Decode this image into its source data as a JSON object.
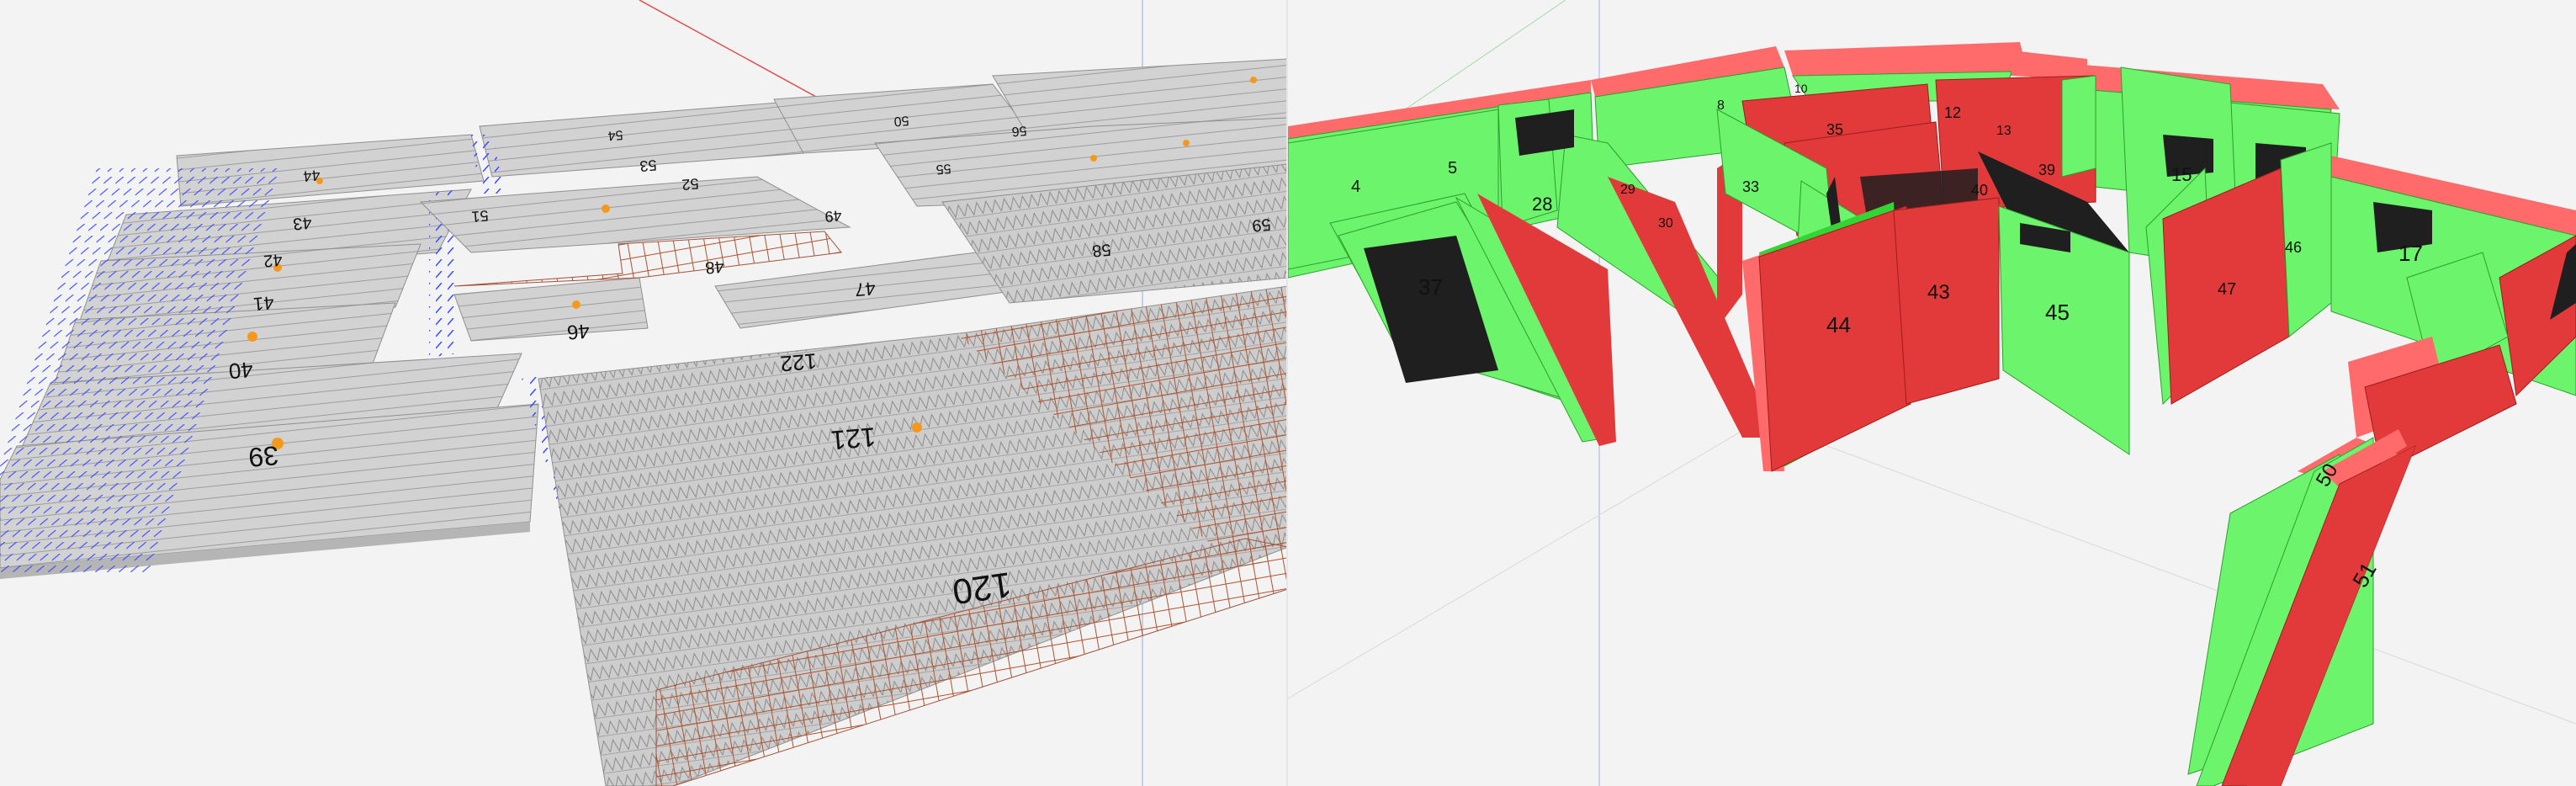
{
  "viewports": {
    "left": {
      "title": "slabs-3d-view",
      "slab_labels": [
        "44",
        "43",
        "42",
        "41",
        "40",
        "39",
        "54",
        "53",
        "52",
        "51",
        "50",
        "49",
        "48",
        "46",
        "47",
        "122",
        "121",
        "120",
        "56",
        "55",
        "58",
        "59"
      ]
    },
    "right": {
      "title": "walls-3d-view",
      "wall_labels": [
        "4",
        "5",
        "28",
        "37",
        "29",
        "30",
        "8",
        "10",
        "33",
        "35",
        "12",
        "13",
        "40",
        "39",
        "15",
        "44",
        "43",
        "45",
        "17",
        "47",
        "46",
        "51",
        "50"
      ]
    }
  },
  "colors": {
    "background": "#f3f3f3",
    "slab_fill": "#cfcfcf",
    "slab_edge": "#9a9a9a",
    "anchor_blue": "#3a4cff",
    "rebar_red": "#b0522e",
    "marker_orange": "#f39a1e",
    "wall_green": "#6cf46c",
    "wall_green_dark": "#33d433",
    "wall_red": "#e23a3a",
    "wall_red_light": "#ff6a6a",
    "opening": "#1f1f1f"
  }
}
